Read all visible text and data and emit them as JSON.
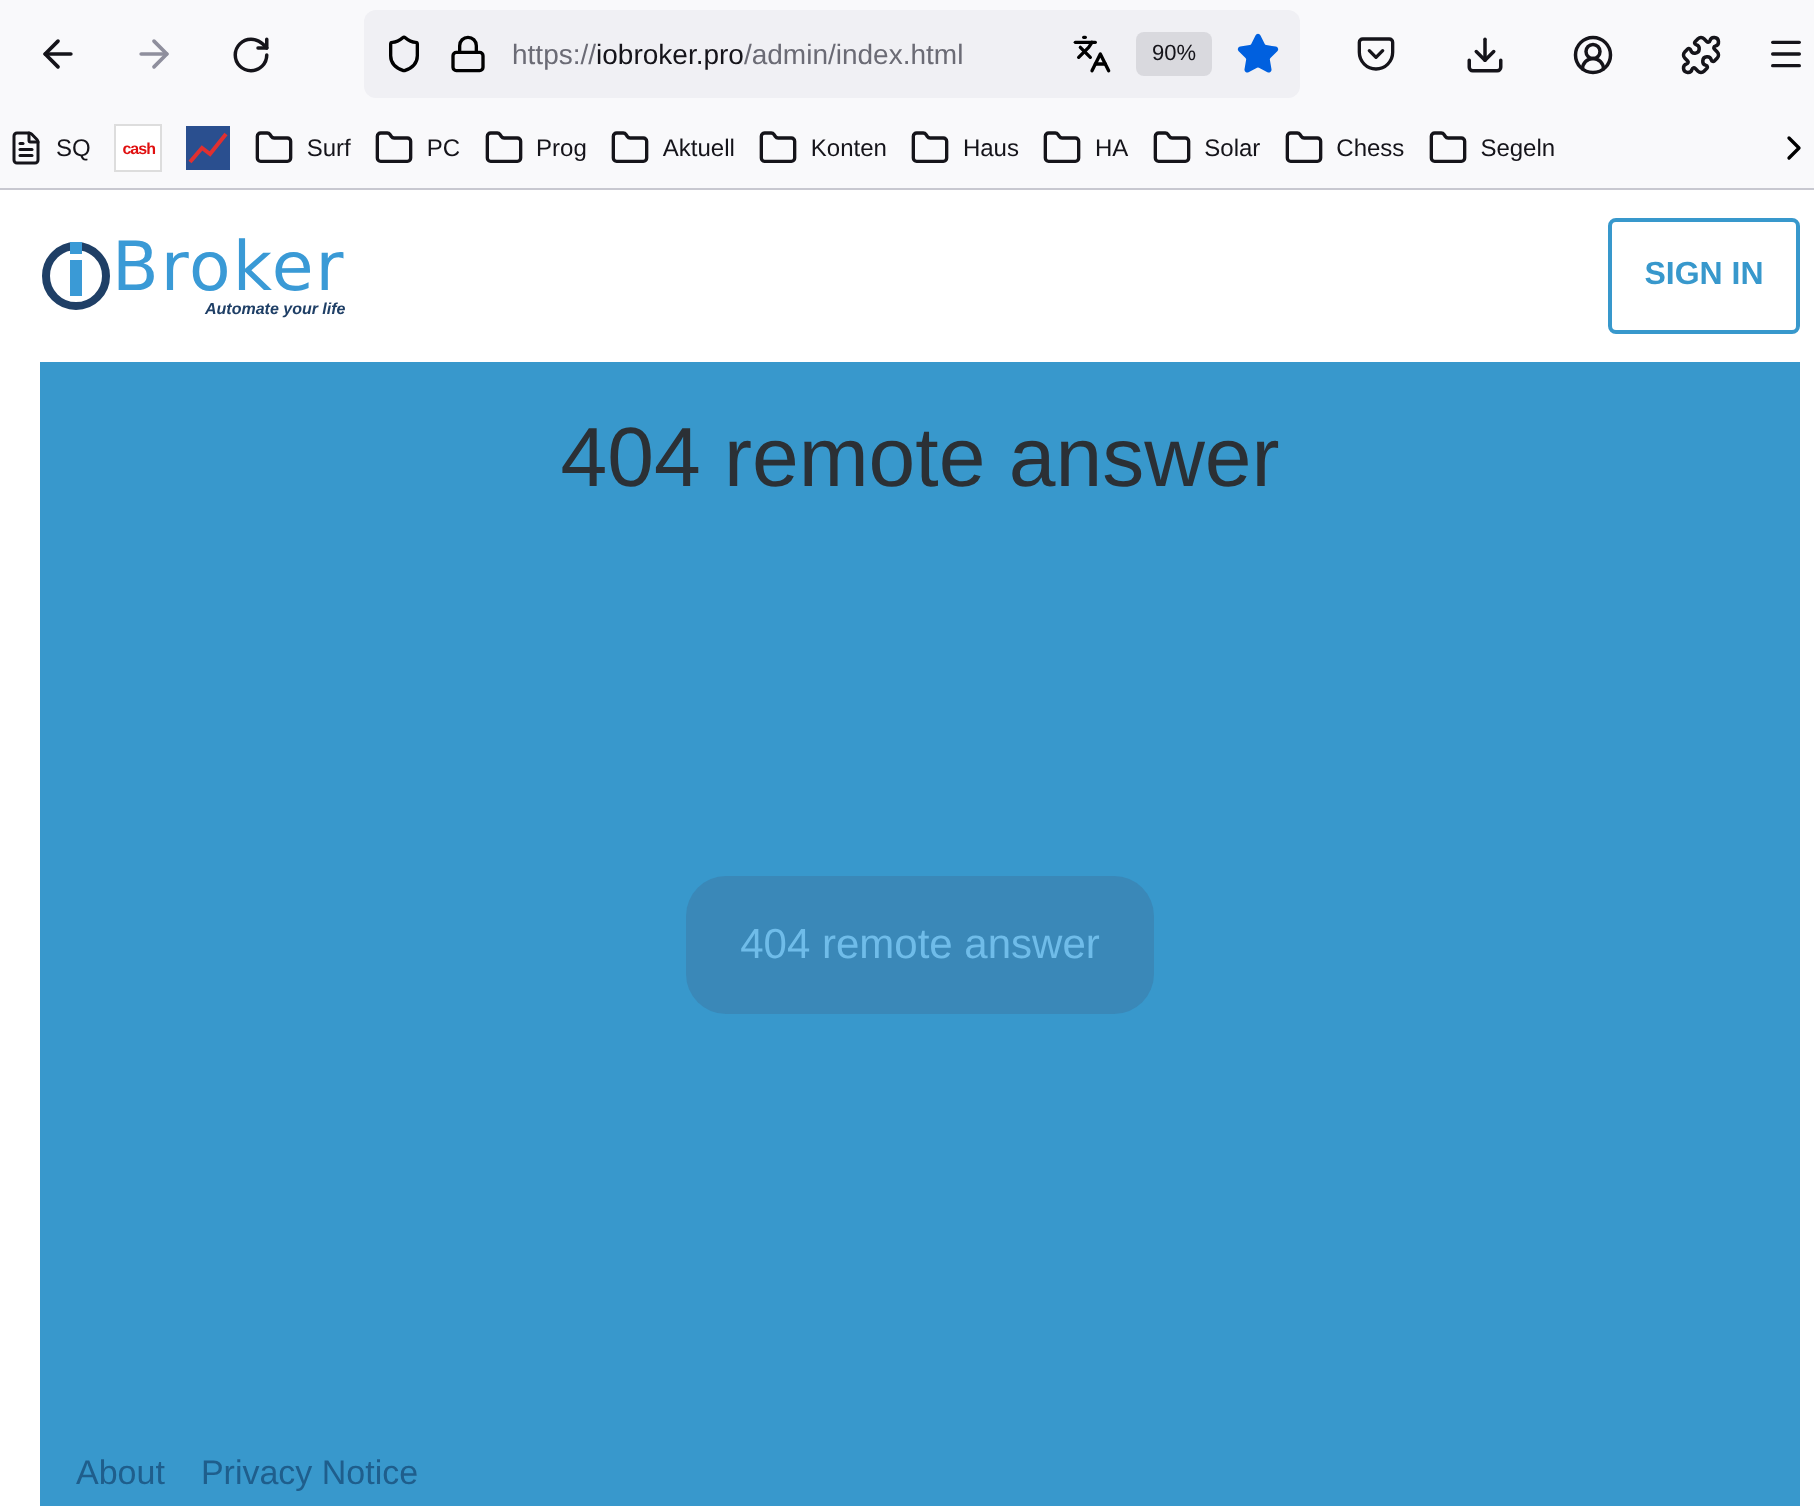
{
  "browser": {
    "url": {
      "scheme": "https://",
      "host": "iobroker.pro",
      "path": "/admin/index.html"
    },
    "zoom": "90%",
    "bookmarked": true,
    "bookmarks": [
      {
        "kind": "page",
        "label": "SQ"
      },
      {
        "kind": "logo",
        "label": "cash"
      },
      {
        "kind": "chart"
      },
      {
        "kind": "folder",
        "label": "Surf"
      },
      {
        "kind": "folder",
        "label": "PC"
      },
      {
        "kind": "folder",
        "label": "Prog"
      },
      {
        "kind": "folder",
        "label": "Aktuell"
      },
      {
        "kind": "folder",
        "label": "Konten"
      },
      {
        "kind": "folder",
        "label": "Haus"
      },
      {
        "kind": "folder",
        "label": "HA"
      },
      {
        "kind": "folder",
        "label": "Solar"
      },
      {
        "kind": "folder",
        "label": "Chess"
      },
      {
        "kind": "folder",
        "label": "Segeln"
      }
    ]
  },
  "header": {
    "logo_name": "Broker",
    "logo_tagline": "Automate your life",
    "sign_in": "SIGN IN"
  },
  "main": {
    "title": "404 remote answer",
    "button": "404 remote answer"
  },
  "footer": {
    "links": [
      "About",
      "Privacy Notice"
    ]
  }
}
